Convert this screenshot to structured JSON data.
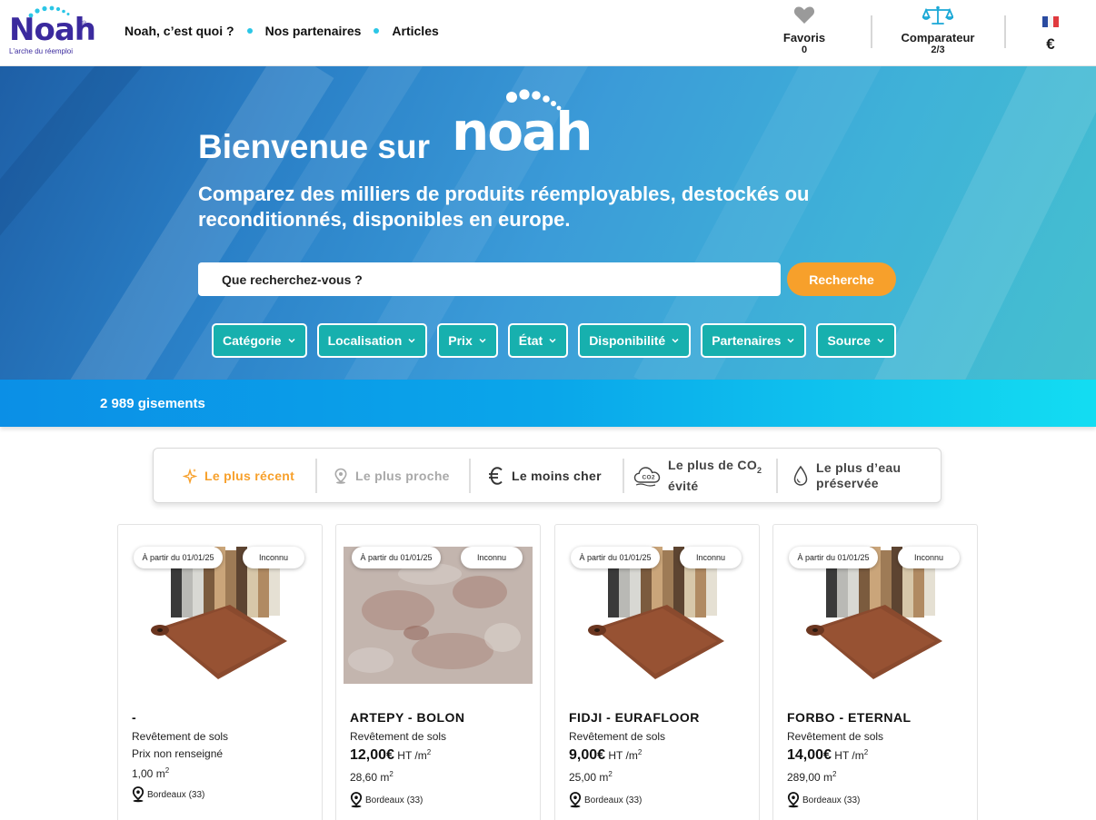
{
  "header": {
    "logo_text": "Noah",
    "logo_tagline": "L'arche du réemploi",
    "nav": [
      {
        "label": "Noah, c’est quoi ?"
      },
      {
        "label": "Nos partenaires"
      },
      {
        "label": "Articles"
      }
    ],
    "favorites": {
      "label": "Favoris",
      "count": "0",
      "icon": "heart-icon"
    },
    "comparator": {
      "label": "Comparateur",
      "count": "2/3",
      "icon": "scale-icon"
    },
    "language_flag": "fr-flag-icon",
    "currency": "€"
  },
  "hero": {
    "title": "Bienvenue sur",
    "logo_text": "noah",
    "subtitle": "Comparez des milliers de produits réemployables, destockés ou reconditionnés, disponibles en europe.",
    "search": {
      "placeholder": "Que recherchez-vous ?",
      "button": "Recherche"
    },
    "filters": [
      {
        "label": "Catégorie"
      },
      {
        "label": "Localisation"
      },
      {
        "label": "Prix"
      },
      {
        "label": "État"
      },
      {
        "label": "Disponibilité"
      },
      {
        "label": "Partenaires"
      },
      {
        "label": "Source"
      }
    ]
  },
  "results": {
    "count_label": "2 989 gisements"
  },
  "sort": {
    "options": [
      {
        "label": "Le plus récent",
        "icon": "sparkle-icon",
        "state": "active"
      },
      {
        "label": "Le plus proche",
        "icon": "location-pin-icon",
        "state": "disabled"
      },
      {
        "label": "Le moins cher",
        "icon": "euro-icon",
        "state": "normal"
      },
      {
        "label_line1": "Le plus de CO",
        "label_sub": "2",
        "label_line2": "évité",
        "icon": "co2-cloud-icon",
        "state": "normal"
      },
      {
        "label_line1": "Le plus d’eau",
        "label_line2": "préservée",
        "icon": "water-drop-icon",
        "state": "normal"
      }
    ]
  },
  "products": [
    {
      "title": "-",
      "category": "Revêtement de sols",
      "price_note": "Prix non renseigné",
      "quantity": "1,00 m",
      "quantity_unit_exp": "2",
      "location": "Bordeaux (33)",
      "badge_date": "À partir du 01/01/25",
      "badge_state": "Inconnu",
      "image": "vinyl-rolls"
    },
    {
      "title": "ARTEPY - BOLON",
      "category": "Revêtement de sols",
      "price": "12,00€",
      "price_unit": "HT /m",
      "price_unit_exp": "2",
      "quantity": "28,60 m",
      "quantity_unit_exp": "2",
      "location": "Bordeaux (33)",
      "badge_date": "À partir du 01/01/25",
      "badge_state": "Inconnu",
      "image": "speckled-carpet"
    },
    {
      "title": "FIDJI - EURAFLOOR",
      "category": "Revêtement de sols",
      "price": "9,00€",
      "price_unit": "HT /m",
      "price_unit_exp": "2",
      "quantity": "25,00 m",
      "quantity_unit_exp": "2",
      "location": "Bordeaux (33)",
      "badge_date": "À partir du 01/01/25",
      "badge_state": "Inconnu",
      "image": "vinyl-rolls"
    },
    {
      "title": "FORBO - ETERNAL",
      "category": "Revêtement de sols",
      "price": "14,00€",
      "price_unit": "HT /m",
      "price_unit_exp": "2",
      "quantity": "289,00 m",
      "quantity_unit_exp": "2",
      "location": "Bordeaux (33)",
      "badge_date": "À partir du 01/01/25",
      "badge_state": "Inconnu",
      "image": "vinyl-rolls"
    }
  ],
  "colors": {
    "brand_purple": "#3b2a9e",
    "accent_cyan": "#2bc6e6",
    "accent_orange": "#f7a02b",
    "filter_teal": "#17b0ae",
    "band_blue": "#0aa6ea"
  }
}
